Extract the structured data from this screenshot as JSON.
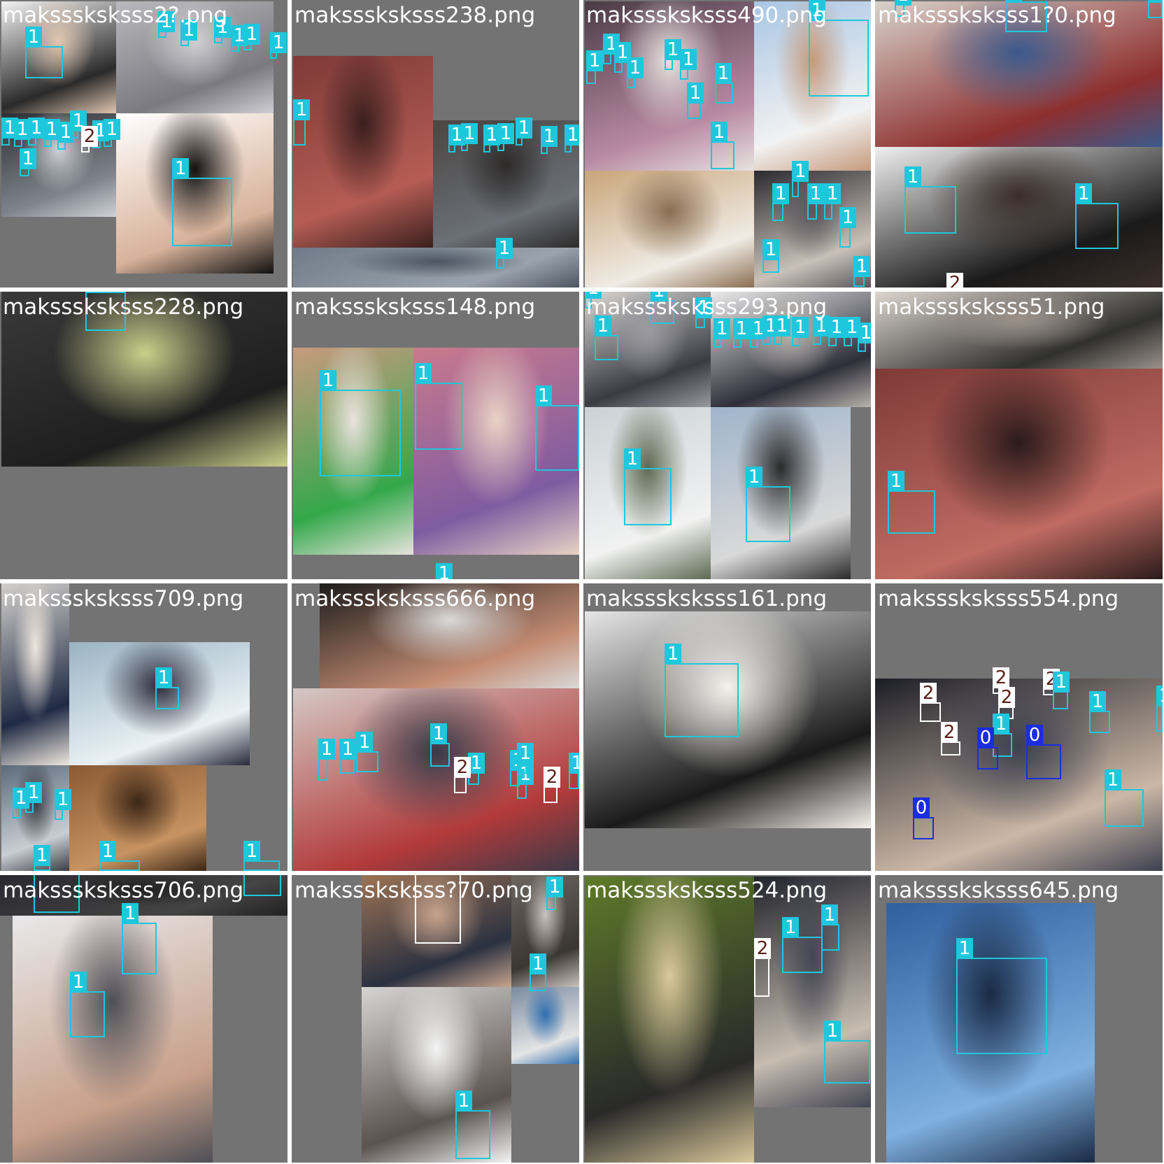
{
  "class_colors": {
    "0": "#1a2ee0",
    "1": "#1fc7dc",
    "2": "#ffffff"
  },
  "tiles": [
    {
      "filename": "maksssksksss2?.png",
      "photos": [
        {
          "type": "office-man-mask",
          "colors": [
            "#f2f2f2",
            "#2a2a2a",
            "#e0c6b0"
          ]
        },
        {
          "type": "street-walkers",
          "colors": [
            "#b9b9bd",
            "#7a7a80",
            "#cfcfd4"
          ]
        },
        {
          "type": "crowd-street",
          "colors": [
            "#2c2f33",
            "#7f838c",
            "#cfd2d8"
          ]
        },
        {
          "type": "man-black-mask",
          "colors": [
            "#ffffff",
            "#d8b29a",
            "#111111"
          ]
        }
      ],
      "detections": [
        {
          "label": "1"
        },
        {
          "label": "1"
        },
        {
          "label": "1"
        },
        {
          "label": "1"
        },
        {
          "label": "1"
        },
        {
          "label": "1"
        },
        {
          "label": "1"
        },
        {
          "label": "1"
        },
        {
          "label": "1"
        },
        {
          "label": "1"
        },
        {
          "label": "1"
        },
        {
          "label": "1"
        },
        {
          "label": "1"
        },
        {
          "label": "1"
        },
        {
          "label": "1"
        },
        {
          "label": "2"
        },
        {
          "label": "1"
        }
      ]
    },
    {
      "filename": "maksssksksss238.png",
      "photos": [
        {
          "type": "red-tassels",
          "colors": [
            "#7e3a38",
            "#b55d54",
            "#3a1f1e"
          ]
        },
        {
          "type": "people-queue",
          "colors": [
            "#4a4642",
            "#6b6f77",
            "#2d2b2a"
          ]
        },
        {
          "type": "city-skyline",
          "colors": [
            "#6f7b88",
            "#9aa3ad",
            "#4c5561"
          ]
        }
      ],
      "detections": [
        {
          "label": "1"
        },
        {
          "label": "1"
        },
        {
          "label": "1"
        },
        {
          "label": "1"
        },
        {
          "label": "1"
        },
        {
          "label": "1"
        },
        {
          "label": "1"
        },
        {
          "label": "1"
        },
        {
          "label": "1"
        }
      ]
    },
    {
      "filename": "maksssksksss490.png",
      "photos": [
        {
          "type": "umbrella-crowd",
          "colors": [
            "#4a3c45",
            "#b98aa5",
            "#e7e2df"
          ]
        },
        {
          "type": "selfie-mask",
          "colors": [
            "#a8c6e4",
            "#f2f2f2",
            "#c59a7d"
          ]
        },
        {
          "type": "brick-building",
          "colors": [
            "#c9a579",
            "#f0ebe4",
            "#8a6e52"
          ]
        },
        {
          "type": "crowd-street",
          "colors": [
            "#2a2a30",
            "#c9c1b8",
            "#5a565c"
          ]
        }
      ],
      "detections": [
        {
          "label": "1"
        },
        {
          "label": "1"
        },
        {
          "label": "1"
        },
        {
          "label": "1"
        },
        {
          "label": "1"
        },
        {
          "label": "1"
        },
        {
          "label": "1"
        },
        {
          "label": "1"
        },
        {
          "label": "1"
        },
        {
          "label": "1"
        },
        {
          "label": "1"
        },
        {
          "label": "1"
        },
        {
          "label": "1"
        },
        {
          "label": "1"
        },
        {
          "label": "1"
        },
        {
          "label": "1"
        },
        {
          "label": "1"
        }
      ]
    },
    {
      "filename": "maksssksksss1?0.png",
      "photos": [
        {
          "type": "shop-staff",
          "colors": [
            "#d7d2cb",
            "#8d2f2f",
            "#3a5a8c"
          ]
        },
        {
          "type": "guards-fur-hats",
          "colors": [
            "#f0f0f0",
            "#1a1a1a",
            "#3b2e2a"
          ]
        }
      ],
      "detections": [
        {
          "label": "1"
        },
        {
          "label": "1"
        },
        {
          "label": "1"
        },
        {
          "label": "1"
        },
        {
          "label": "1"
        },
        {
          "label": "2"
        }
      ]
    },
    {
      "filename": "maksssksksss228.png",
      "photos": [
        {
          "type": "security-guard",
          "colors": [
            "#3a3a3a",
            "#1e1e1e",
            "#c9d08a"
          ]
        }
      ],
      "detections": [
        {
          "label": "1"
        }
      ]
    },
    {
      "filename": "maksssksksss148.png",
      "photos": [
        {
          "type": "news-child",
          "colors": [
            "#c79a7f",
            "#34a84b",
            "#e8e3dc"
          ]
        },
        {
          "type": "women-masks",
          "colors": [
            "#c97a8d",
            "#7f5ba0",
            "#e9d2c5"
          ]
        }
      ],
      "detections": [
        {
          "label": "1"
        },
        {
          "label": "1"
        },
        {
          "label": "1"
        },
        {
          "label": "1"
        }
      ]
    },
    {
      "filename": "maksssksksss293.png",
      "photos": [
        {
          "type": "crowd-masks",
          "colors": [
            "#d9d6d2",
            "#3a3c44",
            "#9a9aa0"
          ]
        },
        {
          "type": "group-photo",
          "colors": [
            "#eaeaea",
            "#2e2e3a",
            "#b7b3ac"
          ]
        },
        {
          "type": "man-selfie",
          "colors": [
            "#cbd2d5",
            "#f2f2f2",
            "#5d6a52"
          ]
        },
        {
          "type": "window-selfie",
          "colors": [
            "#9fb4cb",
            "#d9d9d9",
            "#2b2b2b"
          ]
        }
      ],
      "detections": [
        {
          "label": "1"
        },
        {
          "label": "1"
        },
        {
          "label": "1"
        },
        {
          "label": "1"
        },
        {
          "label": "1"
        },
        {
          "label": "1"
        },
        {
          "label": "1"
        },
        {
          "label": "1"
        },
        {
          "label": "1"
        },
        {
          "label": "1"
        },
        {
          "label": "1"
        },
        {
          "label": "1"
        },
        {
          "label": "1"
        },
        {
          "label": "1"
        },
        {
          "label": "1"
        },
        {
          "label": "1"
        }
      ]
    },
    {
      "filename": "maksssksksss51.png",
      "photos": [
        {
          "type": "news-caption",
          "colors": [
            "#dcd6cf",
            "#30302f",
            "#9b9189"
          ]
        },
        {
          "type": "red-tassels",
          "colors": [
            "#7e3a38",
            "#c06b62",
            "#2b1b1b"
          ]
        }
      ],
      "detections": [
        {
          "label": "1"
        }
      ]
    },
    {
      "filename": "maksssksksss709.png",
      "photos": [
        {
          "type": "striped-shirt",
          "colors": [
            "#d3d0cc",
            "#1f2a44",
            "#efe7dd"
          ]
        },
        {
          "type": "umbrella-woman",
          "colors": [
            "#9ab3c3",
            "#e9f1f5",
            "#2a2a3a"
          ]
        },
        {
          "type": "city-street",
          "colors": [
            "#5b6a7a",
            "#c9ced4",
            "#3b3b42"
          ]
        },
        {
          "type": "wooden-ceiling",
          "colors": [
            "#8a5a34",
            "#c69361",
            "#3b2616"
          ]
        }
      ],
      "detections": [
        {
          "label": "1"
        },
        {
          "label": "1"
        },
        {
          "label": "1"
        },
        {
          "label": "1"
        },
        {
          "label": "1"
        },
        {
          "label": "1"
        },
        {
          "label": "1"
        }
      ]
    },
    {
      "filename": "maksssksksss666.png",
      "photos": [
        {
          "type": "phone-hand",
          "colors": [
            "#1c1c1c",
            "#c48c73",
            "#d9d9d9"
          ]
        },
        {
          "type": "protest-signs",
          "colors": [
            "#d4c8c4",
            "#b23a3a",
            "#3a3a48"
          ]
        }
      ],
      "detections": [
        {
          "label": "1"
        },
        {
          "label": "1"
        },
        {
          "label": "1"
        },
        {
          "label": "1"
        },
        {
          "label": "1"
        },
        {
          "label": "2"
        },
        {
          "label": "1"
        },
        {
          "label": "1"
        },
        {
          "label": "2"
        },
        {
          "label": "1"
        },
        {
          "label": "1"
        }
      ]
    },
    {
      "filename": "maksssksksss161.png",
      "photos": [
        {
          "type": "woman-portrait",
          "colors": [
            "#e6e6e6",
            "#1a1a1a",
            "#f4f1ec"
          ]
        }
      ],
      "detections": [
        {
          "label": "1"
        }
      ]
    },
    {
      "filename": "maksssksksss554.png",
      "photos": [
        {
          "type": "dark-crowd",
          "colors": [
            "#1c1e26",
            "#cbb7a6",
            "#3e4150"
          ]
        }
      ],
      "detections": [
        {
          "label": "2"
        },
        {
          "label": "2"
        },
        {
          "label": "2"
        },
        {
          "label": "2"
        },
        {
          "label": "2"
        },
        {
          "label": "1"
        },
        {
          "label": "1"
        },
        {
          "label": "0"
        },
        {
          "label": "0"
        },
        {
          "label": "1"
        },
        {
          "label": "1"
        },
        {
          "label": "0"
        },
        {
          "label": "1"
        }
      ]
    },
    {
      "filename": "maksssksksss706.png",
      "photos": [
        {
          "type": "mother-child",
          "colors": [
            "#e8e8ea",
            "#c8a08a",
            "#4e4f56"
          ]
        },
        {
          "type": "dark-strip",
          "colors": [
            "#2a2a2f",
            "#444",
            "#222"
          ]
        }
      ],
      "detections": [
        {
          "label": "1"
        },
        {
          "label": "1"
        },
        {
          "label": "1"
        },
        {
          "label": "1"
        }
      ]
    },
    {
      "filename": "maksssksksss?70.png",
      "photos": [
        {
          "type": "bearded-man",
          "colors": [
            "#9c7354",
            "#2b3140",
            "#c7a48e"
          ]
        },
        {
          "type": "motorbikes",
          "colors": [
            "#6b6660",
            "#3a3632",
            "#c9c3bc"
          ]
        },
        {
          "type": "worker-news",
          "colors": [
            "#7a8aa0",
            "#e4e4e4",
            "#2f6fb0"
          ]
        },
        {
          "type": "hooded-mask",
          "colors": [
            "#d6d4d2",
            "#5a5350",
            "#f4f4f4"
          ]
        }
      ],
      "detections": [
        {
          "label": "2"
        },
        {
          "label": "1"
        },
        {
          "label": "1"
        },
        {
          "label": "1"
        }
      ]
    },
    {
      "filename": "maksssksksss524.png",
      "photos": [
        {
          "type": "pm25-package",
          "colors": [
            "#5e7a2a",
            "#2a2a2a",
            "#d9c89a"
          ]
        },
        {
          "type": "dark-crowd",
          "colors": [
            "#22242c",
            "#c6bcb0",
            "#444654"
          ]
        }
      ],
      "detections": [
        {
          "label": "1"
        },
        {
          "label": "1"
        },
        {
          "label": "2"
        },
        {
          "label": "1"
        }
      ]
    },
    {
      "filename": "maksssksksss645.png",
      "photos": [
        {
          "type": "blue-crowd",
          "colors": [
            "#2f5f9e",
            "#7fb0e0",
            "#1a2a44"
          ]
        }
      ],
      "detections": [
        {
          "label": "1"
        }
      ]
    }
  ]
}
